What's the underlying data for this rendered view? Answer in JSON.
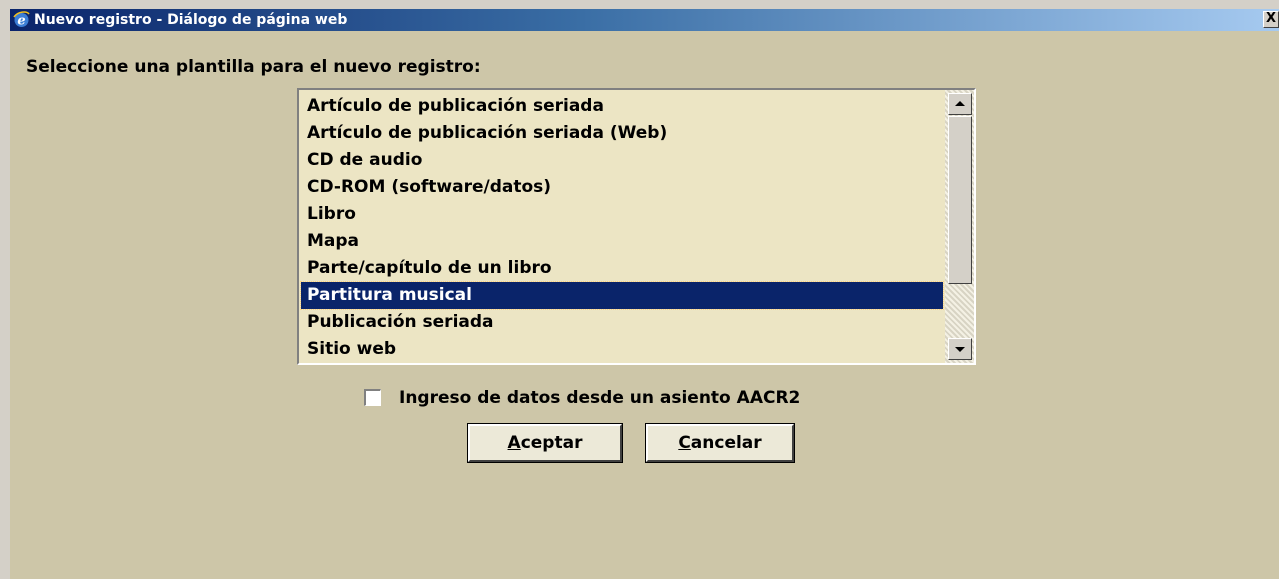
{
  "window": {
    "title": "Nuevo registro - Diálogo de página web",
    "close_label": "X",
    "icon": "ie-icon"
  },
  "dialog": {
    "prompt": "Seleccione una plantilla para el nuevo registro:",
    "templates": [
      "Artículo de publicación seriada",
      "Artículo de publicación seriada (Web)",
      "CD de audio",
      "CD-ROM (software/datos)",
      "Libro",
      "Mapa",
      "Parte/capítulo de un libro",
      "Partitura musical",
      "Publicación seriada",
      "Sitio web"
    ],
    "selected_template": "Partitura musical",
    "aacr2_checkbox": {
      "label": "Ingreso de datos desde un asiento AACR2",
      "checked": false
    },
    "ok_button": {
      "mnemonic": "A",
      "rest": "ceptar"
    },
    "cancel_button": {
      "mnemonic": "C",
      "rest": "ancelar"
    }
  },
  "colors": {
    "title_gradient_start": "#0a246a",
    "title_gradient_end": "#a6caf0",
    "content_background": "#cdc6a8",
    "list_background": "#ece5c4",
    "selection": "#0a246a"
  }
}
